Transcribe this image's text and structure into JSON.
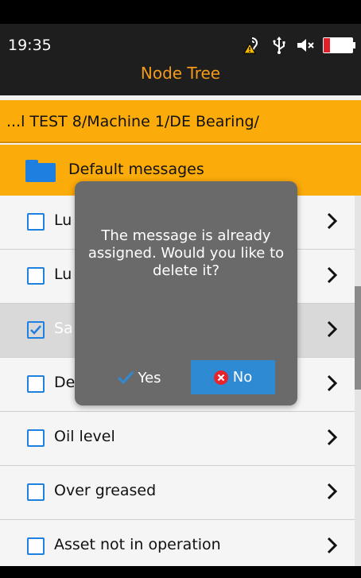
{
  "status": {
    "time": "19:35",
    "icons": [
      "hearing-warning-icon",
      "usb-icon",
      "mute-icon",
      "battery-low-icon"
    ]
  },
  "header": {
    "title": "Node Tree"
  },
  "path": {
    "text": "...l TEST 8/Machine 1/DE Bearing/"
  },
  "folder": {
    "label": "Default messages"
  },
  "list": {
    "items": [
      {
        "label": "Lu",
        "checked": false
      },
      {
        "label": "Lu",
        "checked": false
      },
      {
        "label": "Sa",
        "checked": true
      },
      {
        "label": "De",
        "checked": false
      },
      {
        "label": "Oil level",
        "checked": false
      },
      {
        "label": "Over greased",
        "checked": false
      },
      {
        "label": "Asset not in operation",
        "checked": false
      }
    ]
  },
  "dialog": {
    "message": "The message is already assigned. Would you like to delete it?",
    "yes_label": "Yes",
    "no_label": "No"
  },
  "colors": {
    "accent_orange": "#fbab0a",
    "title_orange": "#f39a1a",
    "checkbox_blue": "#1f80e0",
    "no_button_blue": "#2f8ad4",
    "no_icon_red": "#e8232c"
  }
}
